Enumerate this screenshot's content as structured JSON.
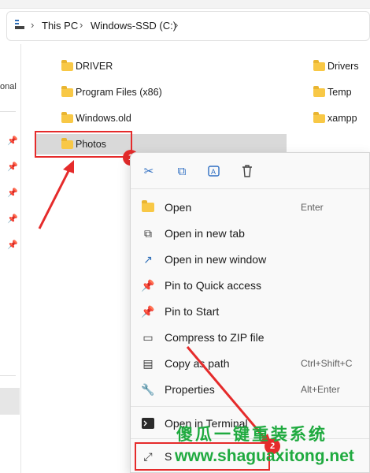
{
  "breadcrumb": {
    "root": "This PC",
    "drive": "Windows-SSD (C:)"
  },
  "nav": {
    "partial_text": "onal"
  },
  "files": [
    {
      "name": "DRIVER"
    },
    {
      "name": "Program Files (x86)"
    },
    {
      "name": "Windows.old"
    },
    {
      "name": "Photos",
      "selected": true
    },
    {
      "name": "Drivers"
    },
    {
      "name": "Temp"
    },
    {
      "name": "xampp"
    }
  ],
  "badges": {
    "step1": "1",
    "step2": "2"
  },
  "context_menu": {
    "toolbar": [
      "cut-icon",
      "copy-icon",
      "rename-icon",
      "delete-icon"
    ],
    "items": [
      {
        "label": "Open",
        "shortcut": "Enter",
        "icon": "folder-icon"
      },
      {
        "label": "Open in new tab",
        "shortcut": "",
        "icon": "new-tab-icon"
      },
      {
        "label": "Open in new window",
        "shortcut": "",
        "icon": "new-window-icon"
      },
      {
        "label": "Pin to Quick access",
        "shortcut": "",
        "icon": "pin-icon"
      },
      {
        "label": "Pin to Start",
        "shortcut": "",
        "icon": "pin-icon"
      },
      {
        "label": "Compress to ZIP file",
        "shortcut": "",
        "icon": "zip-icon"
      },
      {
        "label": "Copy as path",
        "shortcut": "Ctrl+Shift+C",
        "icon": "copy-path-icon"
      },
      {
        "label": "Properties",
        "shortcut": "Alt+Enter",
        "icon": "wrench-icon"
      },
      {
        "label": "Open in Terminal",
        "shortcut": "",
        "icon": "terminal-icon"
      },
      {
        "label": "S",
        "shortcut": "",
        "icon": "show-more-icon"
      }
    ]
  },
  "watermark": {
    "line1": "傻瓜一键重装系统",
    "line2": "www.shaguaxitong.net"
  },
  "colors": {
    "accent": "#2f6fb8",
    "annotation_red": "#e52b2b",
    "selected_bg": "#d9d9d9",
    "folder": "#f8c846",
    "watermark": "#1faa3f"
  }
}
